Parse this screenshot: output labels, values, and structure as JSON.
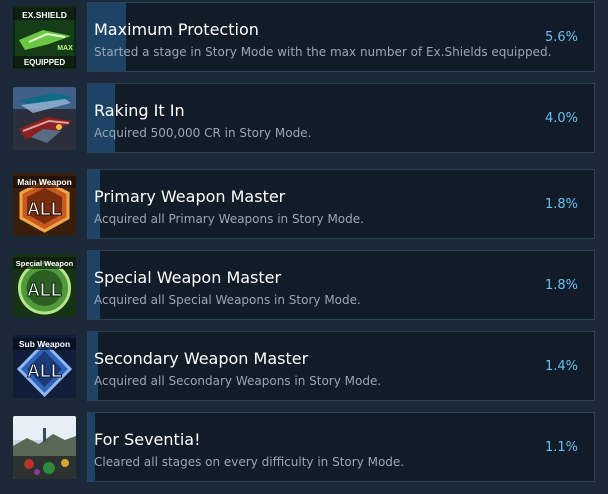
{
  "achievements": [
    {
      "title": "Maximum Protection",
      "description": "Started a stage in Story Mode with the max number of Ex.Shields equipped.",
      "percent_label": "5.6%",
      "percent": 5.6,
      "icon": "ex-shield-max-equipped-icon",
      "icon_text": [
        "EX.SHIELD",
        "MAX",
        "EQUIPPED"
      ]
    },
    {
      "title": "Raking It In",
      "description": "Acquired 500,000 CR in Story Mode.",
      "percent_label": "4.0%",
      "percent": 4.0,
      "icon": "fighter-ship-icon",
      "icon_text": []
    },
    {
      "title": "Primary Weapon Master",
      "description": "Acquired all Primary Weapons in Story Mode.",
      "percent_label": "1.8%",
      "percent": 1.8,
      "icon": "main-weapon-all-icon",
      "icon_text": [
        "Main Weapon",
        "ALL"
      ]
    },
    {
      "title": "Special Weapon Master",
      "description": "Acquired all Special Weapons in Story Mode.",
      "percent_label": "1.8%",
      "percent": 1.8,
      "icon": "special-weapon-all-icon",
      "icon_text": [
        "Special Weapon",
        "ALL"
      ]
    },
    {
      "title": "Secondary Weapon Master",
      "description": "Acquired all Secondary Weapons in Story Mode.",
      "percent_label": "1.4%",
      "percent": 1.4,
      "icon": "sub-weapon-all-icon",
      "icon_text": [
        "Sub Weapon",
        "ALL"
      ]
    },
    {
      "title": "For Seventia!",
      "description": "Cleared all stages on every difficulty in Story Mode.",
      "percent_label": "1.1%",
      "percent": 1.1,
      "icon": "seventia-landscape-icon",
      "icon_text": []
    }
  ],
  "colors": {
    "background": "#1b2838",
    "card": "#121c28",
    "progress": "#1d4466",
    "percent_text": "#66c0f4"
  }
}
